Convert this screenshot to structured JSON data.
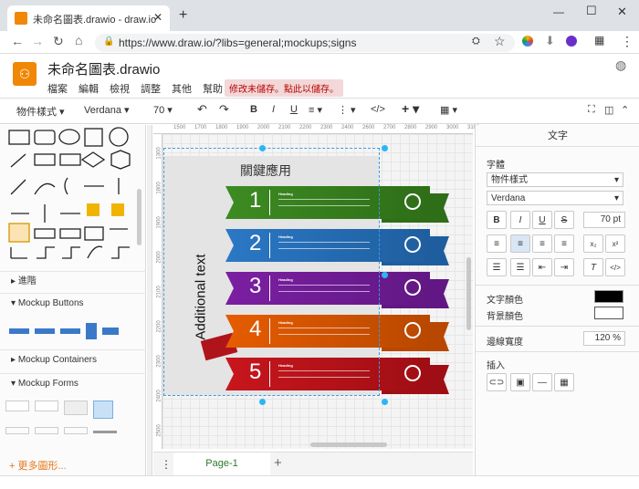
{
  "browser": {
    "tab_title": "未命名圖表.drawio - draw.io",
    "url": "https://www.draw.io/?libs=general;mockups;signs"
  },
  "app": {
    "file_name": "未命名圖表.drawio",
    "menu": [
      "檔案",
      "編輯",
      "檢視",
      "調整",
      "其他",
      "幫助"
    ],
    "unsaved": "修改未儲存。點此以儲存。"
  },
  "toolbar": {
    "style_label": "物件樣式",
    "font": "Verdana",
    "size": "70"
  },
  "sidebar": {
    "sections": [
      "進階",
      "Mockup Buttons",
      "Mockup Containers",
      "Mockup Forms"
    ],
    "more_shapes": "更多圖形..."
  },
  "canvas": {
    "title": "關鍵應用",
    "side_text": "Additional text",
    "ruler_top": [
      "1500",
      "1700",
      "1800",
      "1900",
      "2000",
      "2100",
      "2200",
      "2300",
      "2400",
      "2600",
      "2700",
      "2800",
      "2900",
      "3000",
      "3100"
    ],
    "ruler_left": [
      "1300",
      "1800",
      "1900",
      "2000",
      "2100",
      "2200",
      "2300",
      "2400",
      "2500"
    ],
    "ribbons": [
      {
        "num": "1",
        "color": "#3d8b22",
        "dark": "#2e6e18",
        "heading": "Heading"
      },
      {
        "num": "2",
        "color": "#2b78c5",
        "dark": "#1f5e9e",
        "heading": "Heading"
      },
      {
        "num": "3",
        "color": "#7b1fa2",
        "dark": "#621884",
        "heading": "Heading"
      },
      {
        "num": "4",
        "color": "#e65c00",
        "dark": "#b84800",
        "heading": "Heading"
      },
      {
        "num": "5",
        "color": "#c8161d",
        "dark": "#9e0e14",
        "heading": "Heading"
      }
    ],
    "page_tab": "Page-1"
  },
  "panel": {
    "header": "文字",
    "font_label": "字體",
    "style_select": "物件樣式",
    "font_select": "Verdana",
    "size_value": "70 pt",
    "font_color": "文字顏色",
    "bg_color": "背景顏色",
    "opacity_label": "邊線寬度",
    "opacity_value": "120 %",
    "insert_label": "插入"
  }
}
